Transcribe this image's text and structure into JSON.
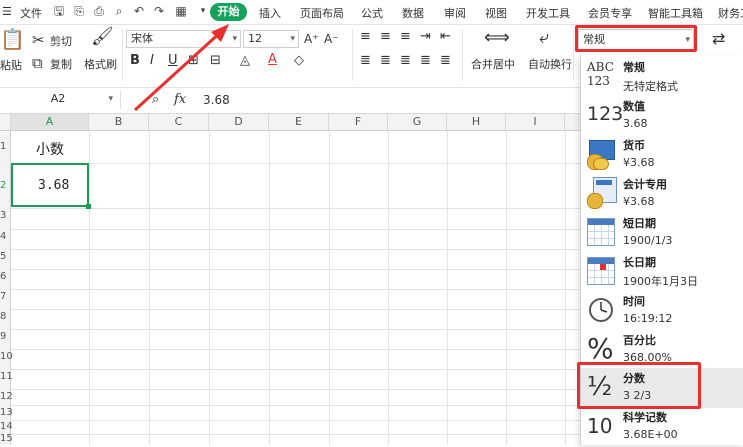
{
  "menu": {
    "file": "文件",
    "tabs": [
      "开始",
      "插入",
      "页面布局",
      "公式",
      "数据",
      "审阅",
      "视图",
      "开发工具",
      "会员专享",
      "智能工具箱",
      "财务工"
    ]
  },
  "ribbon": {
    "paste": "粘贴",
    "cut": "剪切",
    "copy": "复制",
    "format_painter": "格式刷",
    "font_name": "宋体",
    "font_size": "12",
    "bold": "B",
    "italic": "I",
    "underline": "U",
    "font_color_glyph": "A",
    "merge_center": "合并居中",
    "wrap_text": "自动换行",
    "number_format": "常规"
  },
  "formula_bar": {
    "name_box": "A2",
    "fx": "fx",
    "value": "3.68"
  },
  "sheet": {
    "columns": [
      "A",
      "B",
      "C",
      "D",
      "E",
      "F",
      "G",
      "H",
      "I"
    ],
    "rows": [
      "1",
      "2",
      "3",
      "4",
      "5",
      "6",
      "7",
      "8",
      "9",
      "10",
      "11",
      "12",
      "13",
      "14",
      "15"
    ],
    "a1": "小数",
    "a2": "3.68"
  },
  "format_menu": [
    {
      "name": "常规",
      "example": "无特定格式",
      "icon": "general-icon"
    },
    {
      "name": "数值",
      "example": "3.68",
      "icon": "number-icon"
    },
    {
      "name": "货币",
      "example": "¥3.68",
      "icon": "currency-icon"
    },
    {
      "name": "会计专用",
      "example": "¥3.68",
      "icon": "accounting-icon"
    },
    {
      "name": "短日期",
      "example": "1900/1/3",
      "icon": "short-date-icon"
    },
    {
      "name": "长日期",
      "example": "1900年1月3日",
      "icon": "long-date-icon"
    },
    {
      "name": "时间",
      "example": "16:19:12",
      "icon": "time-icon"
    },
    {
      "name": "百分比",
      "example": "368.00%",
      "icon": "percent-icon"
    },
    {
      "name": "分数",
      "example": "3 2/3",
      "icon": "fraction-icon"
    },
    {
      "name": "科学记数",
      "example": "3.68E+00",
      "icon": "scientific-icon"
    }
  ],
  "icon_glyphs": {
    "general": "ABC\n123",
    "number": "123",
    "percent": "%",
    "fraction": "½",
    "scientific": "10"
  },
  "colors": {
    "accent_green": "#15a35b",
    "highlight_red": "#e8312f",
    "selection_green": "#1e9c55"
  }
}
